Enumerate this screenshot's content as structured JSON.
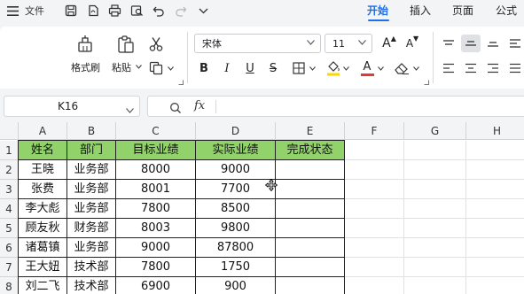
{
  "titlebar": {
    "menu_label": "文件",
    "tabs": [
      "开始",
      "插入",
      "页面",
      "公式"
    ],
    "active_tab": "开始"
  },
  "ribbon": {
    "format_painter": "格式刷",
    "paste": "粘贴",
    "font_name": "宋体",
    "font_size": "11",
    "bold": "B",
    "italic": "I",
    "underline": "U",
    "strike": "S",
    "grow_font": "A",
    "shrink_font": "A",
    "font_color_sample": "A",
    "font_color": "#e53935",
    "fill_color": "#ffd400"
  },
  "formula_bar": {
    "name_box": "K16",
    "fx_label": "fx",
    "formula": ""
  },
  "sheet": {
    "columns": [
      "A",
      "B",
      "C",
      "D",
      "E",
      "F",
      "G",
      "H"
    ],
    "rows": [
      "1",
      "2",
      "3",
      "4",
      "5",
      "6",
      "7",
      "8"
    ],
    "header_color": "#92d26a",
    "table": [
      [
        "姓名",
        "部门",
        "目标业绩",
        "实际业绩",
        "完成状态"
      ],
      [
        "王晓",
        "业务部",
        "8000",
        "9000",
        ""
      ],
      [
        "张费",
        "业务部",
        "8001",
        "7700",
        ""
      ],
      [
        "李大彪",
        "业务部",
        "7800",
        "8500",
        ""
      ],
      [
        "顾友秋",
        "财务部",
        "8003",
        "9800",
        ""
      ],
      [
        "诸葛镇",
        "业务部",
        "9000",
        "87800",
        ""
      ],
      [
        "王大妞",
        "技术部",
        "7800",
        "1750",
        ""
      ],
      [
        "刘二飞",
        "技术部",
        "6900",
        "900",
        ""
      ]
    ]
  }
}
